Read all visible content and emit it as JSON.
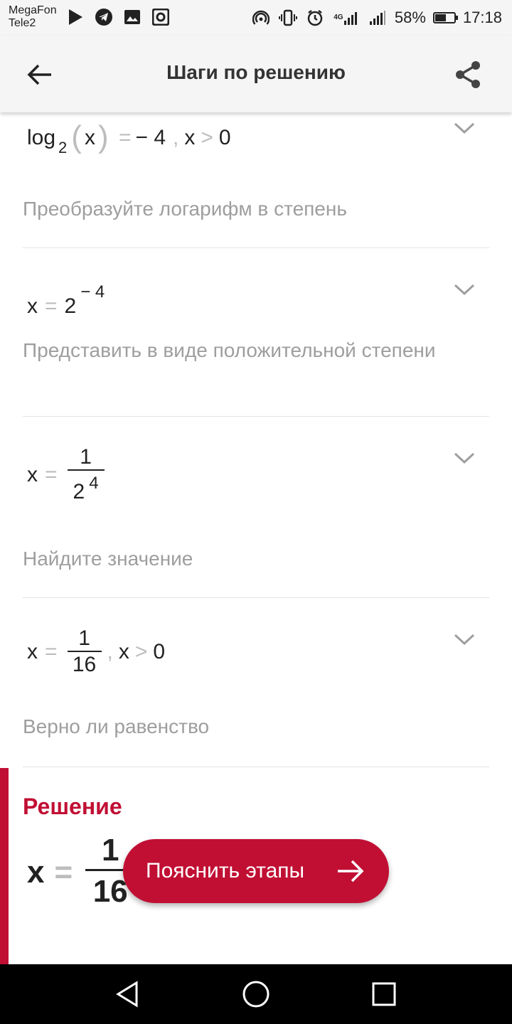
{
  "status": {
    "carrier1": "MegaFon",
    "carrier2": "Tele2",
    "battery": "58%",
    "battery_level": 0.58,
    "network": "4G",
    "time": "17:18"
  },
  "appbar": {
    "title": "Шаги по решению"
  },
  "steps": [
    {
      "math": {
        "log": "log",
        "base": "2",
        "lp": "(",
        "arg": "x",
        "rp": ")",
        "eq": "=",
        "rhs": "− 4",
        "comma": ",",
        "var": "x",
        "gt": ">",
        "zero": "0"
      },
      "description": "Преобразуйте логарифм в степень"
    },
    {
      "math": {
        "var": "x",
        "eq": "=",
        "base": "2",
        "exp": "− 4"
      },
      "description": "Представить в виде положительной степени"
    },
    {
      "math": {
        "var": "x",
        "eq": "=",
        "num": "1",
        "den_base": "2",
        "den_exp": "4"
      },
      "description": "Найдите значение"
    },
    {
      "math": {
        "var": "x",
        "eq": "=",
        "num": "1",
        "den": "16",
        "comma": ",",
        "var2": "x",
        "gt": ">",
        "zero": "0"
      },
      "description": "Верно ли равенство"
    }
  ],
  "solution": {
    "title": "Решение",
    "var": "x",
    "eq": "=",
    "num": "1",
    "den": "16"
  },
  "explain_button": {
    "label": "Пояснить этапы"
  },
  "colors": {
    "accent": "#c10f34",
    "muted_text": "#9e9e9e",
    "operator": "#bdbdbd"
  }
}
